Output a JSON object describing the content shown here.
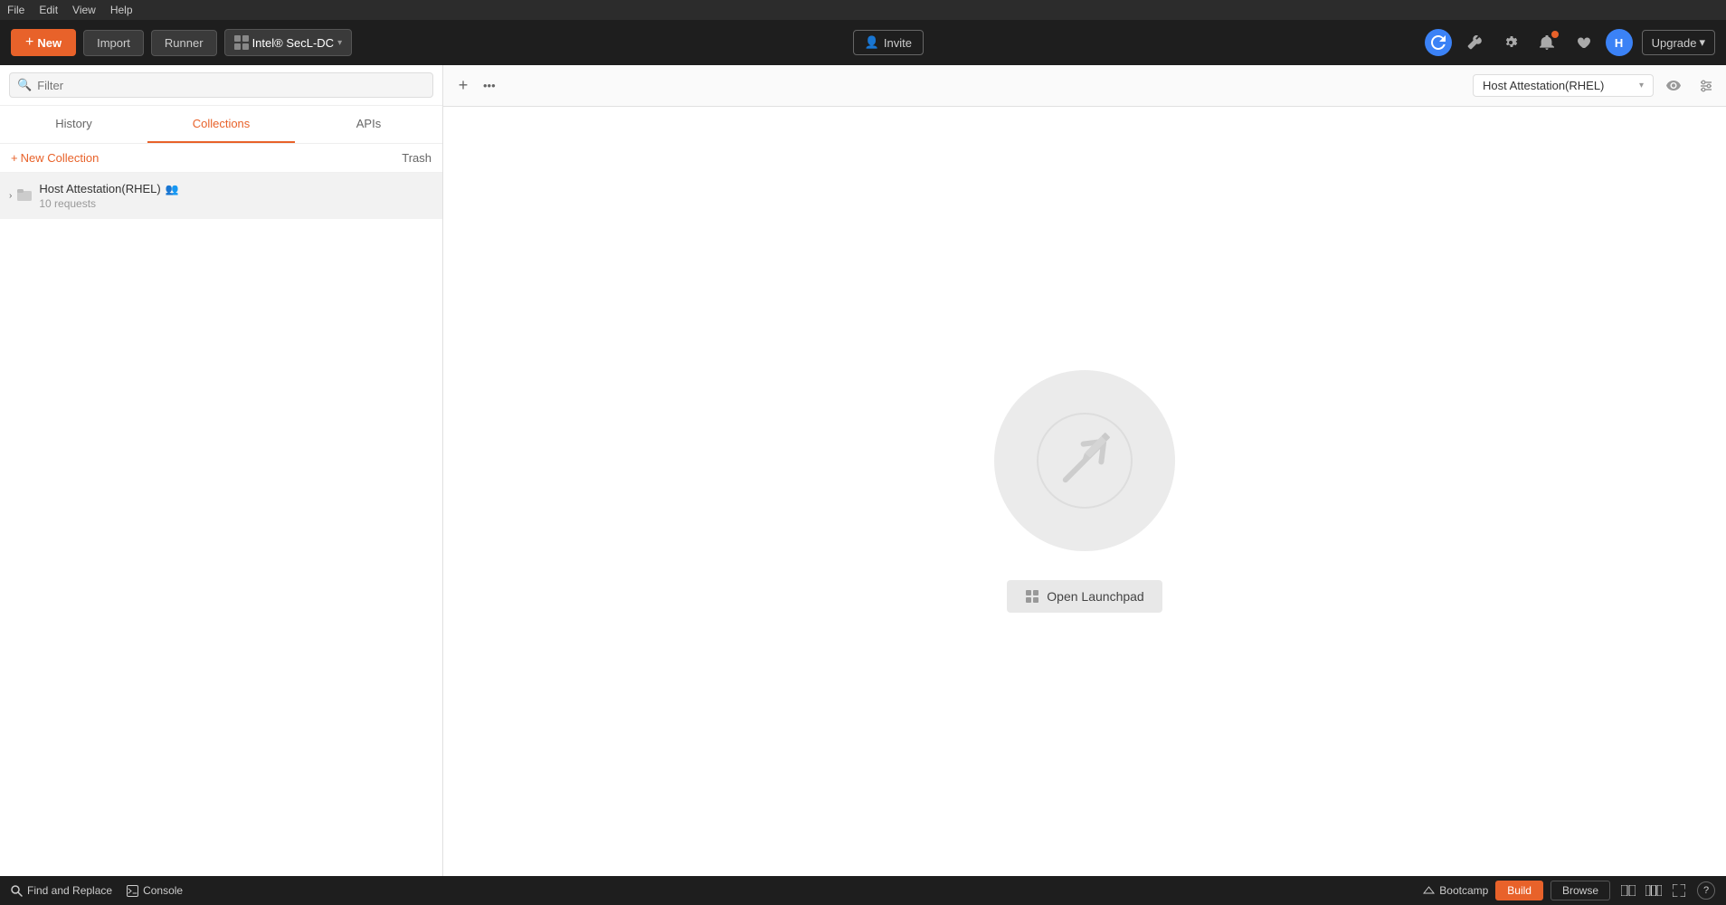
{
  "menuBar": {
    "items": [
      "File",
      "Edit",
      "View",
      "Help"
    ]
  },
  "toolbar": {
    "newLabel": "New",
    "importLabel": "Import",
    "runnerLabel": "Runner",
    "workspaceName": "Intel® SecL-DC",
    "inviteLabel": "Invite",
    "upgradeLabel": "Upgrade",
    "avatarInitial": "H"
  },
  "sidebar": {
    "searchPlaceholder": "Filter",
    "tabs": [
      {
        "label": "History",
        "active": false
      },
      {
        "label": "Collections",
        "active": true
      },
      {
        "label": "APIs",
        "active": false
      }
    ],
    "newCollectionLabel": "New Collection",
    "trashLabel": "Trash",
    "collections": [
      {
        "name": "Host Attestation(RHEL)",
        "requests": "10 requests",
        "hasTeam": true
      }
    ]
  },
  "tabBar": {
    "addTitle": "+",
    "moreTitle": "•••",
    "envSelector": "Host Attestation(RHEL)"
  },
  "centerContent": {
    "openLaunchpadLabel": "Open Launchpad"
  },
  "bottomBar": {
    "findAndReplaceLabel": "Find and Replace",
    "consoleLabel": "Console",
    "bootcampLabel": "Bootcamp",
    "buildLabel": "Build",
    "browseLabel": "Browse",
    "helpLabel": "?"
  }
}
